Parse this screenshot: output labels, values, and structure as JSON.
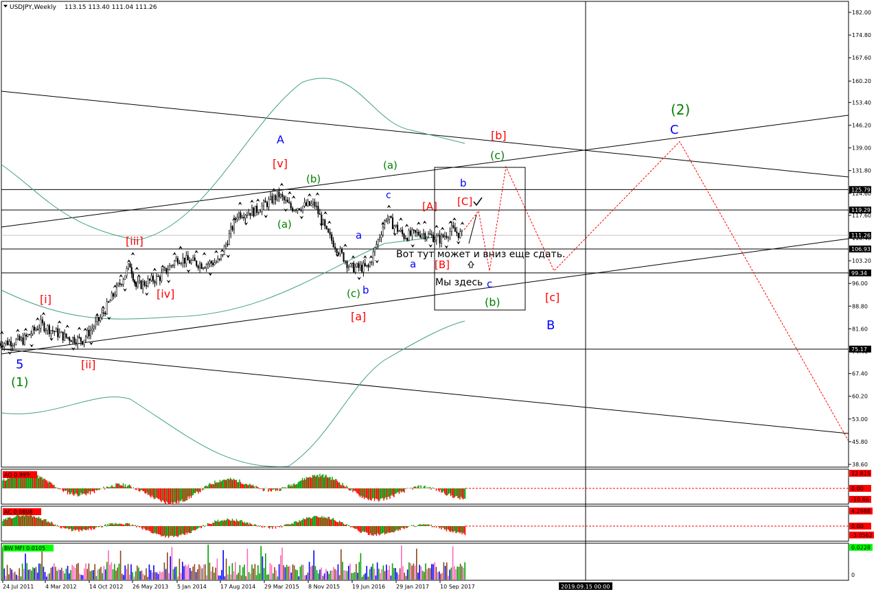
{
  "header": {
    "symbol": "USDJPY,Weekly",
    "ohlc": "113.15 113.40 111.04 111.26"
  },
  "colors": {
    "bull": "#00a000",
    "bear": "#ff0000",
    "wave_blue": "#0000ff",
    "wave_red": "#ff0000",
    "wave_green": "#008000",
    "envelope": "#40a080",
    "forecast": "#ff0000"
  },
  "chart_data": {
    "type": "candlestick",
    "title": "USDJPY,Weekly",
    "price_axis": {
      "ticks": [
        "182.00",
        "174.80",
        "167.60",
        "160.20",
        "153.40",
        "146.20",
        "139.00",
        "131.80",
        "124.60",
        "117.60",
        "110.40",
        "103.20",
        "96.00",
        "88.80",
        "81.60",
        "74.40",
        "67.40",
        "60.20",
        "53.00",
        "45.80",
        "38.60"
      ],
      "ylim": [
        38.6,
        182.0
      ]
    },
    "horizontal_levels": [
      "125.79",
      "119.29",
      "111.26",
      "106.93",
      "99.34",
      "75.17"
    ],
    "current_price": "111.26",
    "time_axis": {
      "labels": [
        "24 Jul 2011",
        "4 Mar 2012",
        "14 Oct 2012",
        "26 May 2013",
        "5 Jan 2014",
        "17 Aug 2014",
        "29 Mar 2015",
        "8 Nov 2015",
        "19 Jun 2016",
        "29 Jan 2017",
        "10 Sep 2017"
      ],
      "cursor_label": "2019.09.15 00:00"
    },
    "price_path": [
      {
        "d": "2011-07",
        "close": 77
      },
      {
        "d": "2011-11",
        "close": 78
      },
      {
        "d": "2012-02",
        "close": 83
      },
      {
        "d": "2012-06",
        "close": 79
      },
      {
        "d": "2012-09",
        "close": 78
      },
      {
        "d": "2012-12",
        "close": 85
      },
      {
        "d": "2013-03",
        "close": 95
      },
      {
        "d": "2013-05",
        "close": 102
      },
      {
        "d": "2013-06",
        "close": 95
      },
      {
        "d": "2013-10",
        "close": 98
      },
      {
        "d": "2014-01",
        "close": 104
      },
      {
        "d": "2014-05",
        "close": 102
      },
      {
        "d": "2014-08",
        "close": 103
      },
      {
        "d": "2014-11",
        "close": 118
      },
      {
        "d": "2015-02",
        "close": 119
      },
      {
        "d": "2015-06",
        "close": 124
      },
      {
        "d": "2015-08",
        "close": 120
      },
      {
        "d": "2015-12",
        "close": 121
      },
      {
        "d": "2016-02",
        "close": 112
      },
      {
        "d": "2016-06",
        "close": 101
      },
      {
        "d": "2016-09",
        "close": 101
      },
      {
        "d": "2016-12",
        "close": 117
      },
      {
        "d": "2017-03",
        "close": 111
      },
      {
        "d": "2017-06",
        "close": 112
      },
      {
        "d": "2017-09",
        "close": 110
      },
      {
        "d": "2017-11",
        "close": 113
      },
      {
        "d": "2018-01",
        "close": 111
      }
    ],
    "wave_labels": [
      {
        "text": "5",
        "color": "blue"
      },
      {
        "text": "(1)",
        "color": "green"
      },
      {
        "text": "[i]",
        "color": "red"
      },
      {
        "text": "[ii]",
        "color": "red"
      },
      {
        "text": "[iii]",
        "color": "red"
      },
      {
        "text": "[iv]",
        "color": "red"
      },
      {
        "text": "[v]",
        "color": "red"
      },
      {
        "text": "A",
        "color": "blue"
      },
      {
        "text": "(a)",
        "color": "green"
      },
      {
        "text": "(b)",
        "color": "green"
      },
      {
        "text": "(c)",
        "color": "green"
      },
      {
        "text": "a",
        "color": "blue"
      },
      {
        "text": "b",
        "color": "blue"
      },
      {
        "text": "[a]",
        "color": "red"
      },
      {
        "text": "c",
        "color": "blue"
      },
      {
        "text": "(a)",
        "color": "green"
      },
      {
        "text": "[A]",
        "color": "red"
      },
      {
        "text": "[B]",
        "color": "red"
      },
      {
        "text": "a",
        "color": "blue"
      },
      {
        "text": "[C]",
        "color": "red"
      },
      {
        "text": "b",
        "color": "blue"
      },
      {
        "text": "c",
        "color": "blue"
      },
      {
        "text": "(b)",
        "color": "green"
      },
      {
        "text": "(c)",
        "color": "green"
      },
      {
        "text": "[b]",
        "color": "red"
      },
      {
        "text": "[c]",
        "color": "red"
      },
      {
        "text": "B",
        "color": "blue"
      },
      {
        "text": "C",
        "color": "blue"
      },
      {
        "text": "(2)",
        "color": "green"
      }
    ],
    "annotations": [
      "Вот тут может и вниз еще сдать.",
      "Мы здесь"
    ],
    "forecast_path": [
      113,
      119,
      100,
      133,
      100,
      141,
      46
    ]
  },
  "indicators": {
    "ao": {
      "label": "AO 0.999",
      "max": "12.815",
      "zero": "0.00",
      "min": "-10.66"
    },
    "ac": {
      "label": "AC 0.0808",
      "max": "4.2988",
      "zero": "0.00",
      "min": "-3.0562"
    },
    "mfi": {
      "label": "BW MFI 0.0105",
      "max": "0.0228",
      "min": "0"
    }
  }
}
